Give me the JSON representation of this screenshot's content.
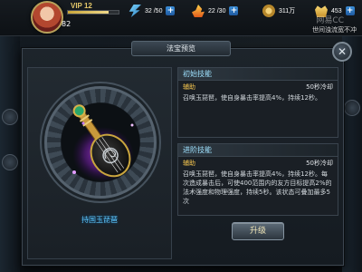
{
  "hud": {
    "vip_label": "VIP 12",
    "level": "82",
    "xp_fraction": 0.8,
    "energy": "32 /50",
    "stamina": "22 /30",
    "coins": "311万",
    "ingots": "453",
    "motto": "世间浊流宽不冲",
    "watermark": "网易CC"
  },
  "dialog": {
    "title": "法宝预览",
    "close_glyph": "✕",
    "artifact_name": "持国玉琵琶",
    "basic_skill": {
      "heading": "初始技能",
      "type": "辅助",
      "cooldown": "50秒冷却",
      "description": "召唤玉琵琶，使自身暴击率提高4%，持续12秒。"
    },
    "advanced_skill": {
      "heading": "进阶技能",
      "type": "辅助",
      "cooldown": "50秒冷却",
      "description": "召唤玉琵琶，使自身暴击率提高4%，持续12秒。每次造成暴击后，可使400范围内的友方目标提高2%的法术强度和物理强度，持续5秒。该状态可叠加最多5次"
    },
    "upgrade_label": "升级"
  },
  "icons": {
    "energy": "lightning-icon",
    "stamina": "flame-icon",
    "coins": "coin-icon",
    "ingots": "gold-ingot-icon"
  },
  "colors": {
    "skill_heading": "#9fe2ff",
    "skill_type": "#f0c24e",
    "artifact_name": "#5fc8ff"
  }
}
